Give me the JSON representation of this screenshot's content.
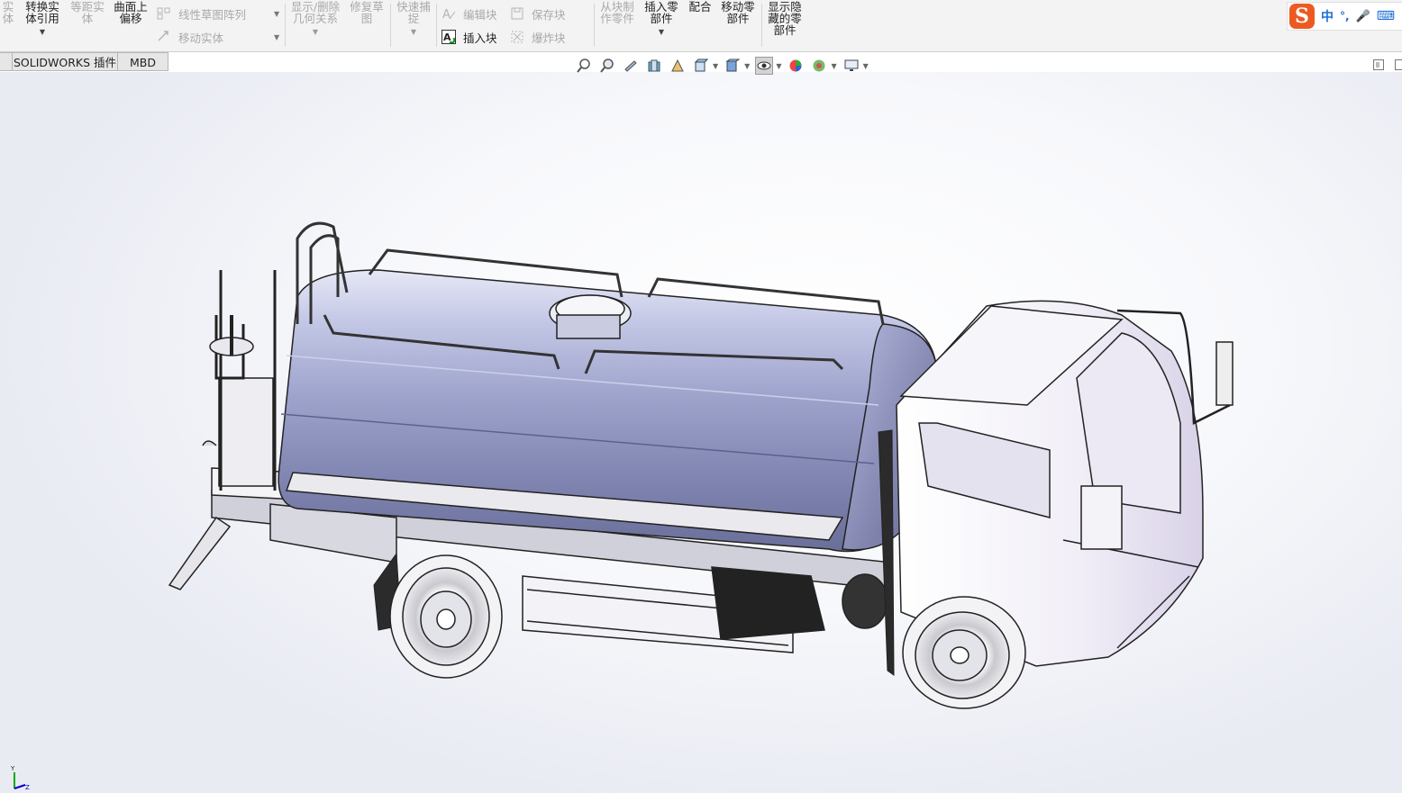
{
  "ribbon": {
    "partial_left": {
      "label": "实\n体",
      "disabled": true
    },
    "convert_entities": {
      "label": "转换实\n体引用"
    },
    "offset_entities": {
      "label": "等距实\n体",
      "disabled": true
    },
    "offset_on_surface": {
      "label": "曲面上\n偏移"
    },
    "linear_pattern": {
      "label": "线性草图阵列",
      "disabled": true
    },
    "move_entities": {
      "label": "移动实体",
      "disabled": true
    },
    "display_delete_relations": {
      "label": "显示/删除\n几何关系",
      "disabled": true
    },
    "repair_sketch": {
      "label": "修复草\n图",
      "disabled": true
    },
    "quick_snaps": {
      "label": "快速捕\n捉",
      "disabled": true
    },
    "edit_block": {
      "label": "编辑块",
      "disabled": true
    },
    "insert_block": {
      "label": "插入块"
    },
    "save_block": {
      "label": "保存块",
      "disabled": true
    },
    "explode_block": {
      "label": "爆炸块",
      "disabled": true
    },
    "make_part_from_block": {
      "label": "从块制\n作零件",
      "disabled": true
    },
    "insert_components": {
      "label": "插入零\n部件"
    },
    "mate": {
      "label": "配合"
    },
    "move_component": {
      "label": "移动零\n部件"
    },
    "show_hidden_components": {
      "label": "显示隐\n藏的零\n部件"
    }
  },
  "ime": {
    "logo": "S",
    "mode": "中",
    "punct": "°,",
    "mic": "🎤",
    "keyboard": "⌨"
  },
  "tabs": [
    {
      "label": "SOLIDWORKS 插件"
    },
    {
      "label": "MBD"
    }
  ],
  "triad": {
    "y": "Y",
    "z": "Z"
  },
  "colors": {
    "tank_body": "#8d92c2",
    "cab": "#f2f0f7",
    "ime_logo": "#ec5a21"
  }
}
